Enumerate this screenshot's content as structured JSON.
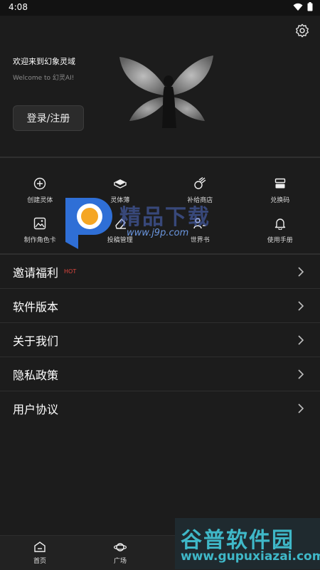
{
  "status_bar": {
    "time": "4:08"
  },
  "header": {
    "welcome_title": "欢迎来到幻象灵域",
    "welcome_subtitle": "Welcome to 幻灵AI!",
    "login_label": "登录/注册"
  },
  "grid": {
    "items": [
      {
        "label": "创建灵体",
        "icon": "plus-circle-icon"
      },
      {
        "label": "灵体薄",
        "icon": "book-icon"
      },
      {
        "label": "补给商店",
        "icon": "meteor-icon"
      },
      {
        "label": "兑换码",
        "icon": "ticket-icon"
      },
      {
        "label": "制作角色卡",
        "icon": "image-icon"
      },
      {
        "label": "投稿管理",
        "icon": "eraser-icon"
      },
      {
        "label": "世界书",
        "icon": "person-book-icon"
      },
      {
        "label": "使用手册",
        "icon": "bell-icon"
      }
    ]
  },
  "menu": {
    "items": [
      {
        "label": "邀请福利",
        "badge": "HOT"
      },
      {
        "label": "软件版本"
      },
      {
        "label": "关于我们"
      },
      {
        "label": "隐私政策"
      },
      {
        "label": "用户协议"
      }
    ]
  },
  "bottom_nav": {
    "items": [
      {
        "label": "首页",
        "icon": "home-icon"
      },
      {
        "label": "广场",
        "icon": "planet-icon"
      }
    ]
  },
  "watermarks": {
    "center_text": "精品下载",
    "center_url": "www.j9p.com",
    "corner_cn": "谷普软件园",
    "corner_en": "www.gupuxiazai.com"
  },
  "colors": {
    "background": "#1c1c1c",
    "hot_badge": "#e0463e",
    "watermark_blue": "#3fb8c8"
  }
}
